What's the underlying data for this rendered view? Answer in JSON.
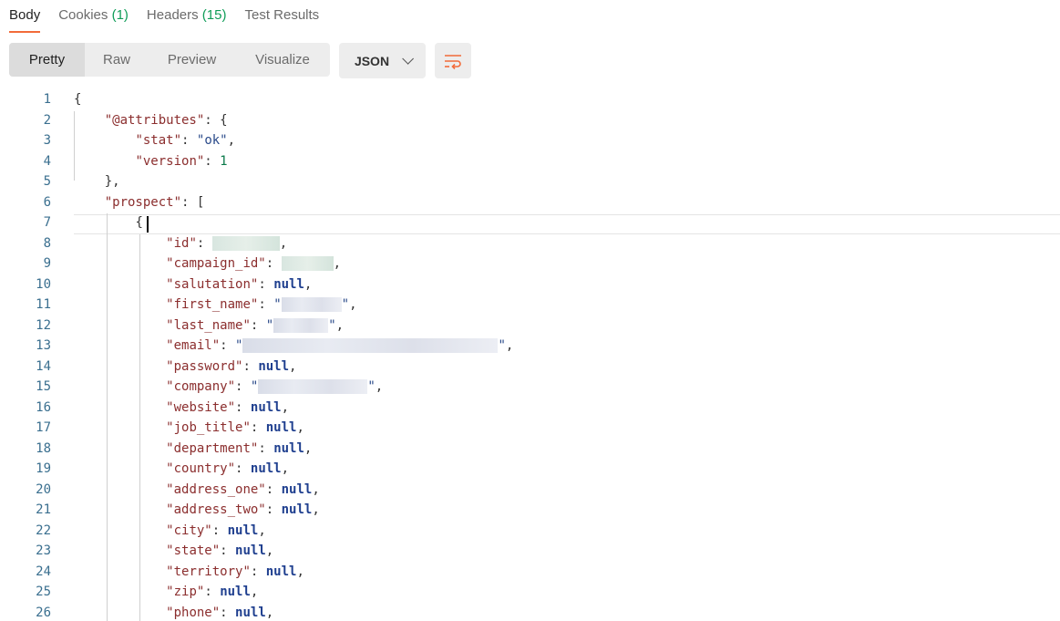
{
  "tabs": {
    "body": "Body",
    "cookies_label": "Cookies",
    "cookies_count": "(1)",
    "headers_label": "Headers",
    "headers_count": "(15)",
    "tests": "Test Results"
  },
  "toolbar": {
    "pretty": "Pretty",
    "raw": "Raw",
    "preview": "Preview",
    "visualize": "Visualize",
    "format": "JSON"
  },
  "colors": {
    "accent": "#f26b3a",
    "count": "#0f9d58"
  },
  "icons": {
    "format_chevron": "chevron-down-icon",
    "wrap": "wrap-lines-icon"
  },
  "code": {
    "line_numbers": [
      "1",
      "2",
      "3",
      "4",
      "5",
      "6",
      "7",
      "8",
      "9",
      "10",
      "11",
      "12",
      "13",
      "14",
      "15",
      "16",
      "17",
      "18",
      "19",
      "20",
      "21",
      "22",
      "23",
      "24",
      "25",
      "26"
    ],
    "brace_open": "{",
    "brace_close": "}",
    "bracket_open": "[",
    "colon": ":",
    "comma": ",",
    "null": "null",
    "attributes_key": "\"@attributes\"",
    "stat_key": "\"stat\"",
    "stat_value": "\"ok\"",
    "version_key": "\"version\"",
    "version_value": "1",
    "prospect_key": "\"prospect\"",
    "id_key": "\"id\"",
    "campaign_id_key": "\"campaign_id\"",
    "salutation_key": "\"salutation\"",
    "first_name_key": "\"first_name\"",
    "last_name_key": "\"last_name\"",
    "email_key": "\"email\"",
    "password_key": "\"password\"",
    "company_key": "\"company\"",
    "website_key": "\"website\"",
    "job_title_key": "\"job_title\"",
    "department_key": "\"department\"",
    "country_key": "\"country\"",
    "address_one_key": "\"address_one\"",
    "address_two_key": "\"address_two\"",
    "city_key": "\"city\"",
    "state_key": "\"state\"",
    "territory_key": "\"territory\"",
    "zip_key": "\"zip\"",
    "phone_key": "\"phone\"",
    "quote": "\""
  }
}
